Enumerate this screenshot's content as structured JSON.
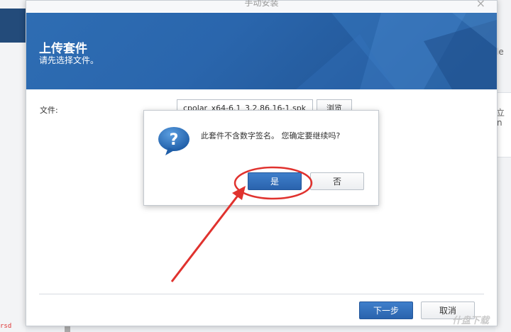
{
  "background": {
    "right_texts": [
      "le",
      "立",
      "n"
    ],
    "corner_text": "rsd"
  },
  "dialog": {
    "title": "手动安装",
    "close_symbol": "×",
    "banner_title": "上传套件",
    "banner_subtitle": "请先选择文件。",
    "file_label": "文件:",
    "file_value": "cpolar_x64-6.1_3.2.86.16-1.spk",
    "browse_label": "浏览",
    "next_label": "下一步",
    "cancel_label": "取消"
  },
  "confirm": {
    "icon": "question-icon",
    "icon_glyph": "?",
    "message": "此套件不含数字签名。 您确定要继续吗?",
    "yes_label": "是",
    "no_label": "否"
  },
  "annotation": {
    "color": "#e0322e"
  },
  "watermark": "什盘下载",
  "colors": {
    "accent": "#2a66ad",
    "banner": "#2e6db3",
    "annotation_red": "#e0322e"
  }
}
